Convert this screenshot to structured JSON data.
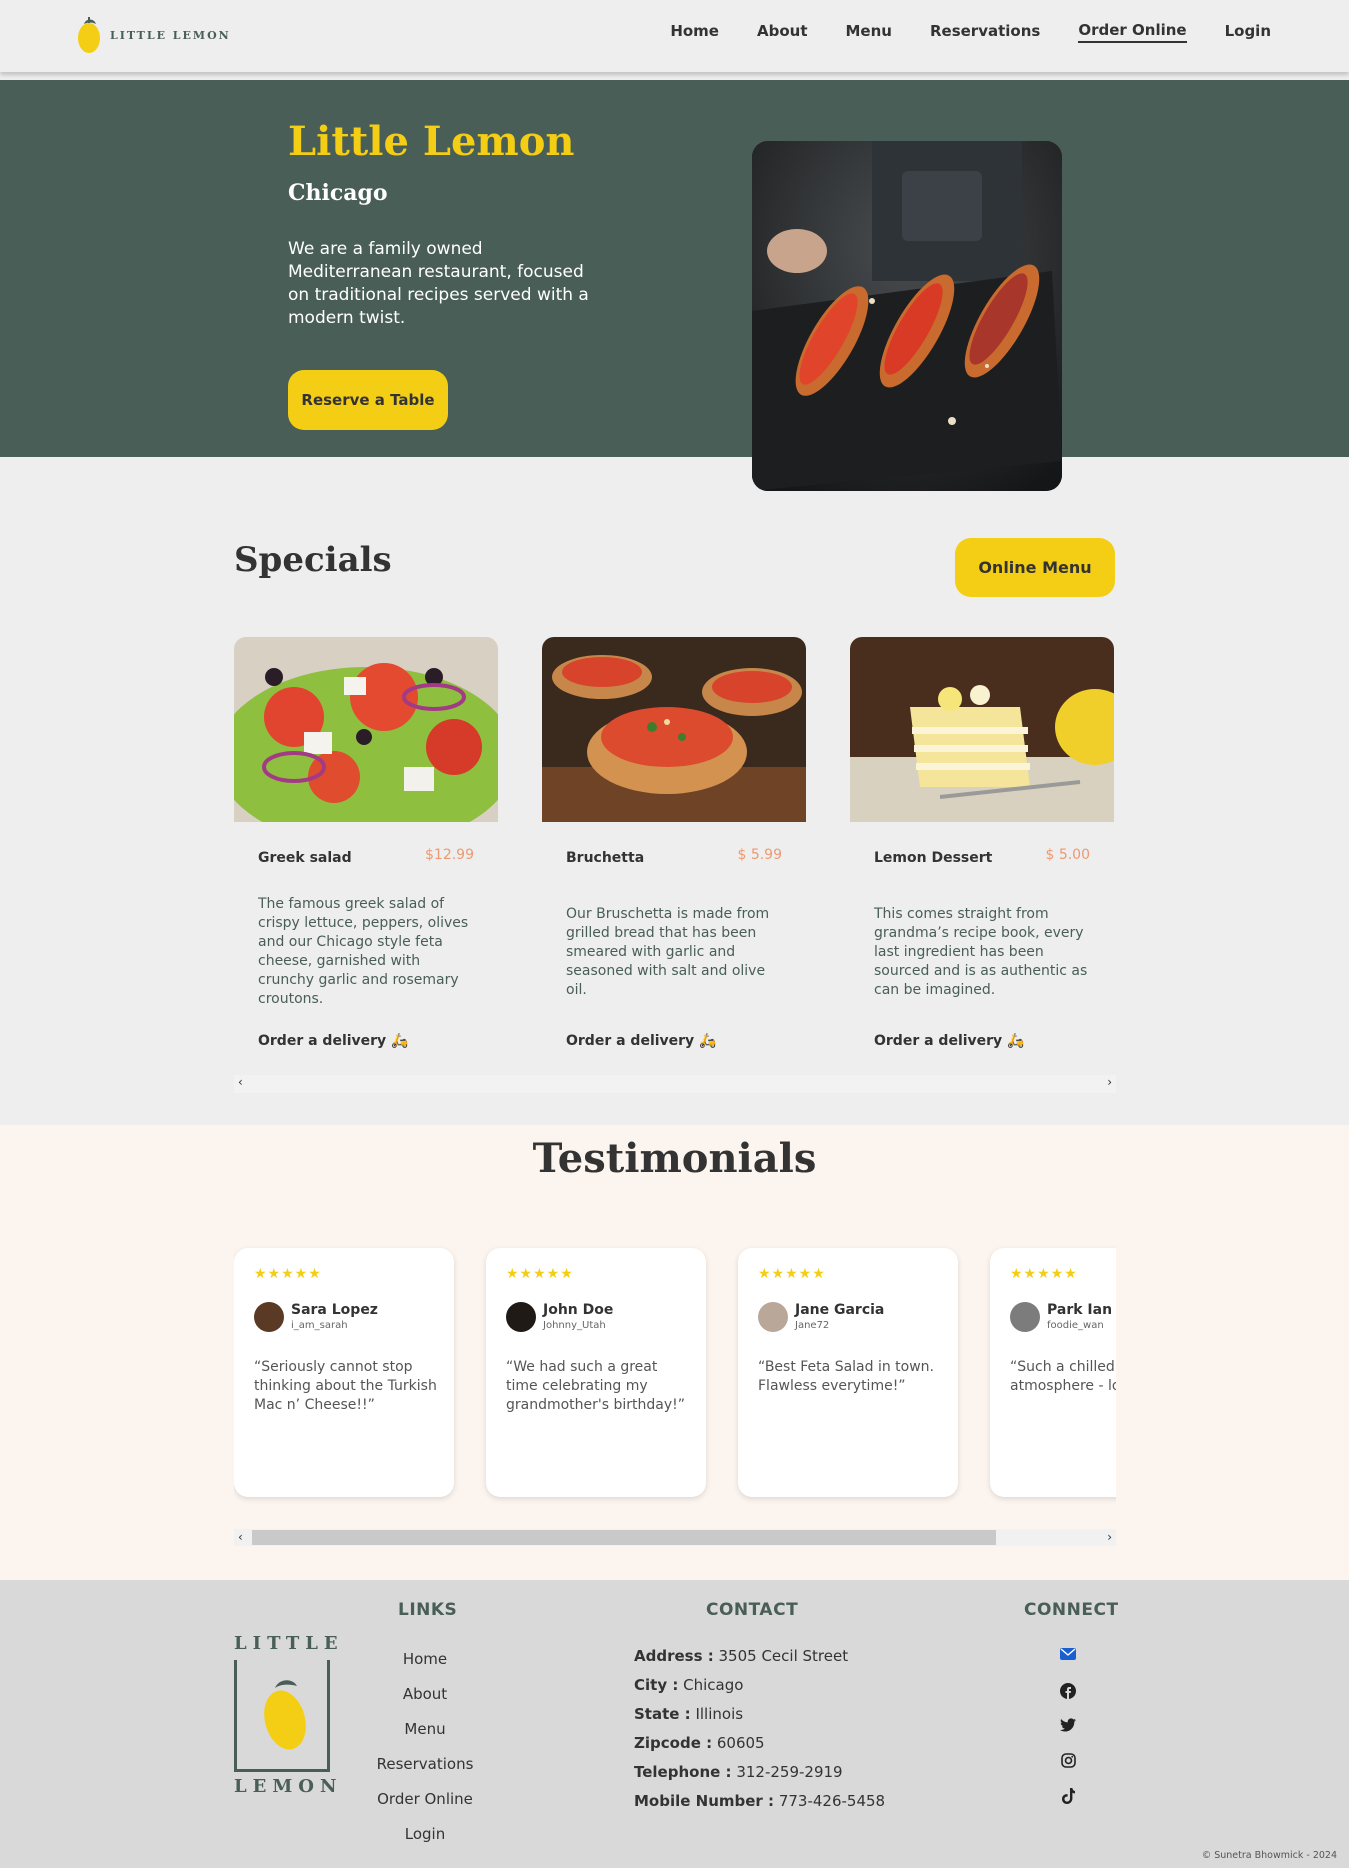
{
  "nav": {
    "logo_text": "LITTLE LEMON",
    "links": [
      {
        "label": "Home"
      },
      {
        "label": "About"
      },
      {
        "label": "Menu"
      },
      {
        "label": "Reservations"
      },
      {
        "label": "Order Online",
        "active": true
      },
      {
        "label": "Login"
      }
    ]
  },
  "hero": {
    "title": "Little Lemon",
    "subtitle": "Chicago",
    "description": "We are a family owned Mediterranean restaurant, focused on traditional recipes served with a modern twist.",
    "button": "Reserve a Table"
  },
  "specials": {
    "title": "Specials",
    "menu_button": "Online Menu",
    "order_label": "Order a delivery",
    "cards": [
      {
        "name": "Greek salad",
        "price": "$12.99",
        "description": "The famous greek salad of crispy lettuce, peppers, olives and our Chicago style feta cheese, garnished with crunchy garlic and rosemary croutons."
      },
      {
        "name": "Bruchetta",
        "price": "$ 5.99",
        "description": "Our Bruschetta is made from grilled bread that has been smeared with garlic and seasoned with salt and olive oil."
      },
      {
        "name": "Lemon Dessert",
        "price": "$ 5.00",
        "description": "This comes straight from grandma’s recipe book, every last ingredient has been sourced and is as authentic as can be imagined."
      }
    ]
  },
  "testimonials": {
    "title": "Testimonials",
    "rating": "★★★★★",
    "items": [
      {
        "name": "Sara Lopez",
        "handle": "i_am_sarah",
        "quote": "“Seriously cannot stop thinking about the Turkish Mac n’ Cheese!!”"
      },
      {
        "name": "John Doe",
        "handle": "Johnny_Utah",
        "quote": "“We had such a great time celebrating my grandmother's birthday!”"
      },
      {
        "name": "Jane Garcia",
        "handle": "Jane72",
        "quote": "“Best Feta Salad in town. Flawless everytime!”"
      },
      {
        "name": "Park Ian",
        "handle": "foodie_wan",
        "quote": "“Such a chilled out atmosphere - love it!”"
      }
    ]
  },
  "footer": {
    "logo_top": "LITTLE",
    "logo_bottom": "LEMON",
    "links_heading": "LINKS",
    "contact_heading": "CONTACT",
    "connect_heading": "CONNECT",
    "links": [
      "Home",
      "About",
      "Menu",
      "Reservations",
      "Order Online",
      "Login"
    ],
    "contact": [
      {
        "label": "Address :",
        "value": "3505 Cecil Street"
      },
      {
        "label": "City :",
        "value": "Chicago"
      },
      {
        "label": "State :",
        "value": "Illinois"
      },
      {
        "label": "Zipcode :",
        "value": "60605"
      },
      {
        "label": "Telephone :",
        "value": "312-259-2919"
      },
      {
        "label": "Mobile Number :",
        "value": "773-426-5458"
      }
    ],
    "social_icons": [
      "envelope-icon",
      "facebook-icon",
      "twitter-icon",
      "instagram-icon",
      "tiktok-icon"
    ],
    "copyright": "© Sunetra Bhowmick - 2024"
  },
  "colors": {
    "primary_green": "#495e57",
    "primary_yellow": "#f4ce14",
    "price_orange": "#ee9972",
    "testimonial_bg": "#fcf4ee"
  }
}
